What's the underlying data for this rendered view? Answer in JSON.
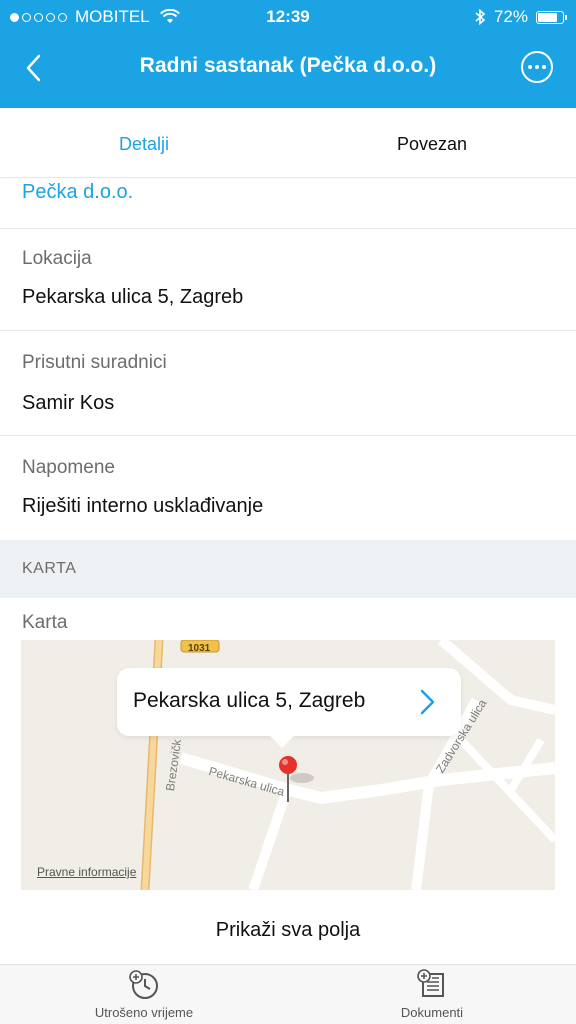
{
  "status_bar": {
    "carrier": "MOBITEL",
    "time": "12:39",
    "battery": "72%",
    "battery_level": 0.72
  },
  "navbar": {
    "title": "Radni sastanak (Pečka d.o.o.)",
    "back_icon": "chevron-left-icon",
    "more_icon": "more-options-icon"
  },
  "tabs": [
    {
      "label": "Detalji",
      "active": true
    },
    {
      "label": "Povezan",
      "active": false
    }
  ],
  "details": {
    "company_link": "Pečka d.o.o.",
    "fields": [
      {
        "label": "Lokacija",
        "value": "Pekarska ulica 5, Zagreb"
      },
      {
        "label": "Prisutni suradnici",
        "value": "Samir Kos"
      },
      {
        "label": "Napomene",
        "value": "Riješiti interno usklađivanje"
      }
    ]
  },
  "map_section": {
    "section_title": "KARTA",
    "field_label": "Karta",
    "callout": "Pekarska ulica 5, Zagreb",
    "legal": "Pravne informacije",
    "streets": [
      "Pekarska ulica",
      "Brezovičk",
      "Zadvorska ulica",
      "1031"
    ]
  },
  "actions": {
    "show_all": "Prikaži sva polja"
  },
  "bottom_bar": [
    {
      "label": "Utrošeno vrijeme",
      "icon": "time-spent-icon"
    },
    {
      "label": "Dokumenti",
      "icon": "documents-icon"
    }
  ],
  "colors": {
    "accent": "#1ba3e3",
    "pin": "#e5322d"
  }
}
